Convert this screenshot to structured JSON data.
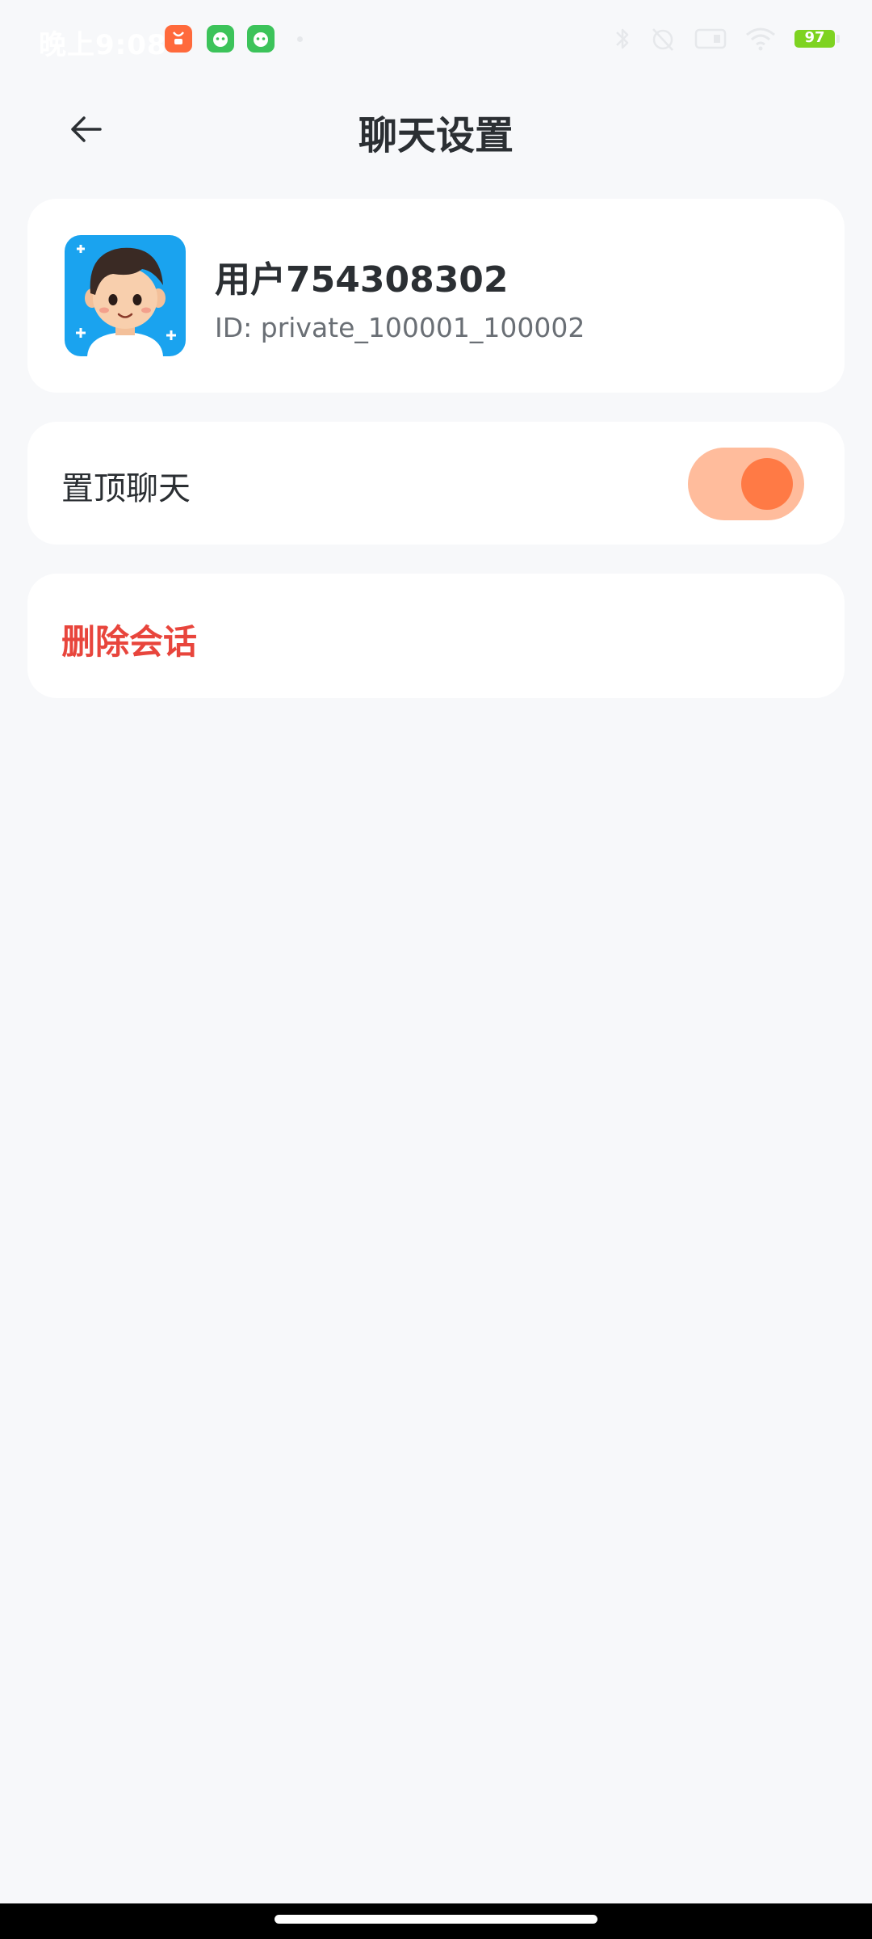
{
  "status_bar": {
    "time": "晚上9:08",
    "battery": "97",
    "icons": [
      "app-orange-icon",
      "app-green-icon",
      "app-green-icon",
      "bluetooth-icon",
      "alarm-off-icon",
      "sim-icon",
      "wifi-icon",
      "battery-icon"
    ]
  },
  "header": {
    "title": "聊天设置",
    "back_icon": "arrow-left-icon"
  },
  "profile": {
    "name": "用户754308302",
    "id_text": "ID: private_100001_100002",
    "avatar_icon": "cartoon-boy-avatar"
  },
  "settings": {
    "pin_label": "置顶聊天",
    "pin_enabled": true,
    "delete_label": "删除会话"
  },
  "colors": {
    "accent": "#ff7a45",
    "accent_track": "#ffbc9c",
    "danger": "#e8453c",
    "background": "#f7f8fa"
  }
}
